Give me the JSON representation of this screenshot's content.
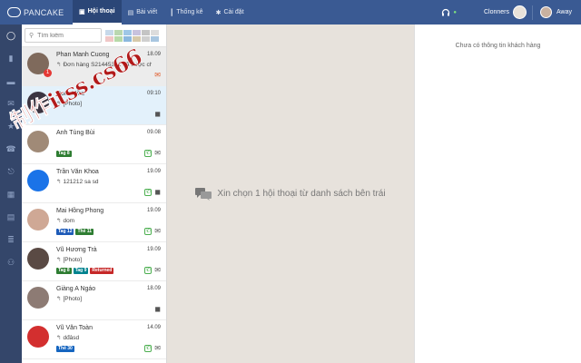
{
  "app": {
    "brand": "PANCAKE",
    "nav": [
      {
        "label": "Hội thoại",
        "icon": "chat-icon",
        "active": true
      },
      {
        "label": "Bài viết",
        "icon": "post-icon",
        "active": false
      },
      {
        "label": "Thống kê",
        "icon": "chart-icon",
        "active": false
      },
      {
        "label": "Cài đặt",
        "icon": "gear-icon",
        "active": false
      }
    ],
    "page_name": "Clonners",
    "user_status": "Away",
    "accent": "#3a5a93"
  },
  "rail": [
    "circle-icon",
    "bookmark-icon",
    "inbox-icon",
    "mail-icon",
    "star-icon",
    "phone-icon",
    "exit-icon",
    "calendar-icon",
    "archive-icon",
    "list-icon",
    "users-icon"
  ],
  "search": {
    "placeholder": "Tìm kiếm"
  },
  "tag_colors": [
    "#c7d9ea",
    "#b9d7b0",
    "#9fc7e6",
    "#c8c2dd",
    "#c4c4c4",
    "#dcdcdc",
    "#f0c7c7",
    "#b7d9a8",
    "#8bb8de",
    "#d6c9aa",
    "#cfcfcf",
    "#a8c6e0"
  ],
  "conversations": [
    {
      "name": "Phan Manh Cuong",
      "time": "18.09",
      "snippet": "Đơn hàng S21445391 đã được chu...",
      "badge": "1",
      "icons": [
        "mail-red"
      ],
      "tags": [],
      "avatar": "#7f6a5c",
      "state": "highlight"
    },
    {
      "name": "Dom Mike",
      "time": "09:10",
      "snippet": "[Photo]",
      "badge": "",
      "icons": [
        "chat"
      ],
      "tags": [],
      "avatar": "#3b3440",
      "state": "selected"
    },
    {
      "name": "Anh Tùng Bùi",
      "time": "09.08",
      "snippet": "",
      "badge": "",
      "icons": [
        "phone",
        "mail"
      ],
      "tags": [
        {
          "label": "Tag 8",
          "color": "#2e7d32"
        }
      ],
      "avatar": "#a08a77",
      "state": ""
    },
    {
      "name": "Trần Văn Khoa",
      "time": "19.09",
      "snippet": "121212 sa sd",
      "badge": "",
      "icons": [
        "phone",
        "chat"
      ],
      "tags": [],
      "avatar": "#1a73e8",
      "state": ""
    },
    {
      "name": "Mai Hồng Phong",
      "time": "19.09",
      "snippet": "dom",
      "badge": "",
      "icons": [
        "phone",
        "mail"
      ],
      "tags": [
        {
          "label": "Tag 12",
          "color": "#1e5bb8"
        },
        {
          "label": "Thẻ 11",
          "color": "#2e7d32"
        }
      ],
      "avatar": "#cfa895",
      "state": ""
    },
    {
      "name": "Vũ Hương Trà",
      "time": "19.09",
      "snippet": "[Photo]",
      "badge": "",
      "icons": [
        "phone",
        "mail"
      ],
      "tags": [
        {
          "label": "Tag 8",
          "color": "#2e7d32"
        },
        {
          "label": "Tag 9",
          "color": "#00838f"
        },
        {
          "label": "Returned",
          "color": "#c62828"
        }
      ],
      "avatar": "#5a4a44",
      "state": ""
    },
    {
      "name": "Giàng A Ngáo",
      "time": "18.09",
      "snippet": "[Photo]",
      "badge": "",
      "icons": [
        "chat"
      ],
      "tags": [],
      "avatar": "#8d7b74",
      "state": ""
    },
    {
      "name": "Vũ Văn Toàn",
      "time": "14.09",
      "snippet": "dđâsd",
      "badge": "",
      "icons": [
        "phone",
        "mail"
      ],
      "tags": [
        {
          "label": "Thẻ 30",
          "color": "#1565c0"
        }
      ],
      "avatar": "#d32f2f",
      "state": ""
    }
  ],
  "center_message": "Xin chọn 1 hội thoại từ danh sách bên trái",
  "right_message": "Chưa có thông tin khách hàng",
  "watermark": "制作itss.cs66"
}
